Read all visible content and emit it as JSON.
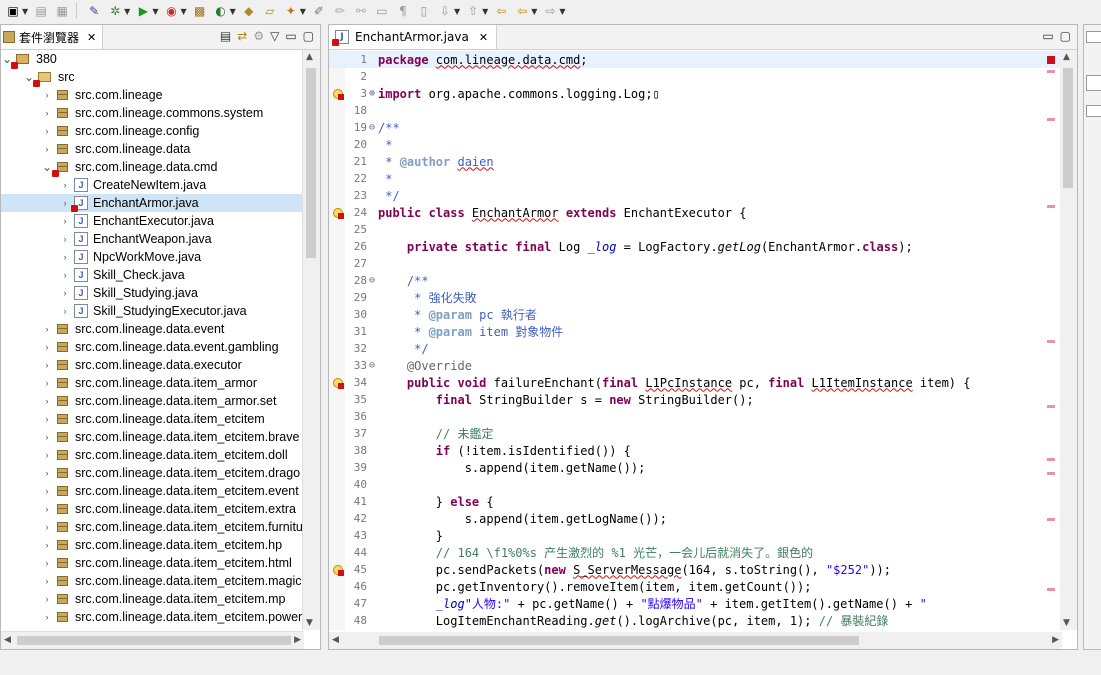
{
  "package_explorer": {
    "title": "套件瀏覽器",
    "tree": [
      {
        "label": "380",
        "type": "project",
        "level": 0,
        "expanded": true,
        "error": true
      },
      {
        "label": "src",
        "type": "srcfolder",
        "level": 1,
        "expanded": true,
        "error": true
      },
      {
        "label": "src.com.lineage",
        "type": "package",
        "level": 2
      },
      {
        "label": "src.com.lineage.commons.system",
        "type": "package",
        "level": 2
      },
      {
        "label": "src.com.lineage.config",
        "type": "package",
        "level": 2
      },
      {
        "label": "src.com.lineage.data",
        "type": "package",
        "level": 2
      },
      {
        "label": "src.com.lineage.data.cmd",
        "type": "package",
        "level": 2,
        "expanded": true,
        "error": true
      },
      {
        "label": "CreateNewItem.java",
        "type": "java",
        "level": 3
      },
      {
        "label": "EnchantArmor.java",
        "type": "java",
        "level": 3,
        "selected": true,
        "error": true
      },
      {
        "label": "EnchantExecutor.java",
        "type": "java",
        "level": 3
      },
      {
        "label": "EnchantWeapon.java",
        "type": "java",
        "level": 3
      },
      {
        "label": "NpcWorkMove.java",
        "type": "java",
        "level": 3
      },
      {
        "label": "Skill_Check.java",
        "type": "java",
        "level": 3
      },
      {
        "label": "Skill_Studying.java",
        "type": "java",
        "level": 3
      },
      {
        "label": "Skill_StudyingExecutor.java",
        "type": "java",
        "level": 3
      },
      {
        "label": "src.com.lineage.data.event",
        "type": "package",
        "level": 2
      },
      {
        "label": "src.com.lineage.data.event.gambling",
        "type": "package",
        "level": 2
      },
      {
        "label": "src.com.lineage.data.executor",
        "type": "package",
        "level": 2
      },
      {
        "label": "src.com.lineage.data.item_armor",
        "type": "package",
        "level": 2
      },
      {
        "label": "src.com.lineage.data.item_armor.set",
        "type": "package",
        "level": 2
      },
      {
        "label": "src.com.lineage.data.item_etcitem",
        "type": "package",
        "level": 2
      },
      {
        "label": "src.com.lineage.data.item_etcitem.brave",
        "type": "package",
        "level": 2
      },
      {
        "label": "src.com.lineage.data.item_etcitem.doll",
        "type": "package",
        "level": 2
      },
      {
        "label": "src.com.lineage.data.item_etcitem.drago",
        "type": "package",
        "level": 2
      },
      {
        "label": "src.com.lineage.data.item_etcitem.event",
        "type": "package",
        "level": 2
      },
      {
        "label": "src.com.lineage.data.item_etcitem.extra",
        "type": "package",
        "level": 2
      },
      {
        "label": "src.com.lineage.data.item_etcitem.furnitu",
        "type": "package",
        "level": 2
      },
      {
        "label": "src.com.lineage.data.item_etcitem.hp",
        "type": "package",
        "level": 2
      },
      {
        "label": "src.com.lineage.data.item_etcitem.html",
        "type": "package",
        "level": 2
      },
      {
        "label": "src.com.lineage.data.item_etcitem.magic",
        "type": "package",
        "level": 2
      },
      {
        "label": "src.com.lineage.data.item_etcitem.mp",
        "type": "package",
        "level": 2
      },
      {
        "label": "src.com.lineage.data.item_etcitem.power",
        "type": "package",
        "level": 2
      }
    ]
  },
  "editor": {
    "tab_title": "EnchantArmor.java",
    "lines": [
      {
        "n": "1",
        "fold": "",
        "mk": "",
        "cur": true,
        "segs": [
          [
            "kw",
            "package "
          ],
          [
            "und",
            "com.lineage.data.cmd"
          ],
          [
            "",
            "; "
          ]
        ]
      },
      {
        "n": "2",
        "fold": "",
        "mk": "",
        "segs": []
      },
      {
        "n": "3",
        "fold": "⊕",
        "mk": "err",
        "segs": [
          [
            "kw",
            "import "
          ],
          [
            "",
            "org.apache.commons.logging.Log;▯"
          ]
        ]
      },
      {
        "n": "18",
        "fold": "",
        "mk": "",
        "segs": []
      },
      {
        "n": "19",
        "fold": "⊖",
        "mk": "",
        "segs": [
          [
            "jd",
            "/**"
          ]
        ]
      },
      {
        "n": "20",
        "fold": "",
        "mk": "",
        "segs": [
          [
            "jd",
            " *"
          ]
        ]
      },
      {
        "n": "21",
        "fold": "",
        "mk": "",
        "segs": [
          [
            "jd",
            " * "
          ],
          [
            "jdt",
            "@author "
          ],
          [
            "jd und",
            "daien"
          ]
        ]
      },
      {
        "n": "22",
        "fold": "",
        "mk": "",
        "segs": [
          [
            "jd",
            " *"
          ]
        ]
      },
      {
        "n": "23",
        "fold": "",
        "mk": "",
        "segs": [
          [
            "jd",
            " */"
          ]
        ]
      },
      {
        "n": "24",
        "fold": "",
        "mk": "err",
        "segs": [
          [
            "kw",
            "public class "
          ],
          [
            "und",
            "EnchantArmor"
          ],
          [
            "kw",
            " extends "
          ],
          [
            "",
            "EnchantExecutor {"
          ]
        ]
      },
      {
        "n": "25",
        "fold": "",
        "mk": "",
        "segs": []
      },
      {
        "n": "26",
        "fold": "",
        "mk": "",
        "segs": [
          [
            "",
            "    "
          ],
          [
            "kw",
            "private static final "
          ],
          [
            "",
            "Log "
          ],
          [
            "fld it",
            "_log"
          ],
          [
            "",
            " = LogFactory."
          ],
          [
            "it",
            "getLog"
          ],
          [
            "",
            "(EnchantArmor."
          ],
          [
            "kw",
            "class"
          ],
          [
            "",
            ");"
          ]
        ]
      },
      {
        "n": "27",
        "fold": "",
        "mk": "",
        "segs": []
      },
      {
        "n": "28",
        "fold": "⊖",
        "mk": "",
        "segs": [
          [
            "jd",
            "    /**"
          ]
        ]
      },
      {
        "n": "29",
        "fold": "",
        "mk": "",
        "segs": [
          [
            "jd",
            "     * 強化失敗"
          ]
        ]
      },
      {
        "n": "30",
        "fold": "",
        "mk": "",
        "segs": [
          [
            "jd",
            "     * "
          ],
          [
            "jdt",
            "@param "
          ],
          [
            "jd",
            "pc 執行者"
          ]
        ]
      },
      {
        "n": "31",
        "fold": "",
        "mk": "",
        "segs": [
          [
            "jd",
            "     * "
          ],
          [
            "jdt",
            "@param "
          ],
          [
            "jd",
            "item 對象物件"
          ]
        ]
      },
      {
        "n": "32",
        "fold": "",
        "mk": "",
        "segs": [
          [
            "jd",
            "     */"
          ]
        ]
      },
      {
        "n": "33",
        "fold": "⊖",
        "mk": "",
        "segs": [
          [
            "ann",
            "    @Override"
          ]
        ]
      },
      {
        "n": "34",
        "fold": "",
        "mk": "err",
        "segs": [
          [
            "",
            "    "
          ],
          [
            "kw",
            "public void "
          ],
          [
            "",
            "failureEnchant("
          ],
          [
            "kw",
            "final "
          ],
          [
            "und",
            "L1PcInstance"
          ],
          [
            "",
            " pc, "
          ],
          [
            "kw",
            "final "
          ],
          [
            "und",
            "L1ItemInstance"
          ],
          [
            "",
            " item) {"
          ]
        ]
      },
      {
        "n": "35",
        "fold": "",
        "mk": "",
        "segs": [
          [
            "",
            "        "
          ],
          [
            "kw",
            "final "
          ],
          [
            "",
            "StringBuilder s = "
          ],
          [
            "kw",
            "new "
          ],
          [
            "",
            "StringBuilder();"
          ]
        ]
      },
      {
        "n": "36",
        "fold": "",
        "mk": "",
        "segs": []
      },
      {
        "n": "37",
        "fold": "",
        "mk": "",
        "segs": [
          [
            "cm",
            "        // 未鑑定"
          ]
        ]
      },
      {
        "n": "38",
        "fold": "",
        "mk": "",
        "segs": [
          [
            "",
            "        "
          ],
          [
            "kw",
            "if "
          ],
          [
            "",
            "(!item.isIdentified()) {"
          ]
        ]
      },
      {
        "n": "39",
        "fold": "",
        "mk": "",
        "segs": [
          [
            "",
            "            s.append(item.getName());"
          ]
        ]
      },
      {
        "n": "40",
        "fold": "",
        "mk": "",
        "segs": []
      },
      {
        "n": "41",
        "fold": "",
        "mk": "",
        "segs": [
          [
            "",
            "        } "
          ],
          [
            "kw",
            "else "
          ],
          [
            "",
            "{"
          ]
        ]
      },
      {
        "n": "42",
        "fold": "",
        "mk": "",
        "segs": [
          [
            "",
            "            s.append(item.getLogName());"
          ]
        ]
      },
      {
        "n": "43",
        "fold": "",
        "mk": "",
        "segs": [
          [
            "",
            "        }"
          ]
        ]
      },
      {
        "n": "44",
        "fold": "",
        "mk": "",
        "segs": [
          [
            "cm",
            "        // 164 \\f1%0%s 产生激烈的 %1 光芒，一会儿后就消失了。銀色的"
          ]
        ]
      },
      {
        "n": "45",
        "fold": "",
        "mk": "err",
        "segs": [
          [
            "",
            "        pc.sendPackets("
          ],
          [
            "kw",
            "new "
          ],
          [
            "und",
            "S_ServerMessage"
          ],
          [
            "",
            "(164, s.toString(), "
          ],
          [
            "str",
            "\"$252\""
          ],
          [
            "",
            "));"
          ]
        ]
      },
      {
        "n": "46",
        "fold": "",
        "mk": "",
        "segs": [
          [
            "",
            "        pc.getInventory().removeItem(item, item.getCount());"
          ]
        ]
      },
      {
        "n": "47",
        "fold": "",
        "mk": "",
        "segs": [
          [
            "",
            "        "
          ],
          [
            "fld it",
            "_log"
          ],
          [
            ".info(",
            ""
          ],
          [
            "str",
            "\"人物:\""
          ],
          [
            "",
            " + pc.getName() + "
          ],
          [
            "str",
            "\"點爆物品\""
          ],
          [
            "",
            " + item.getItem().getName() + "
          ],
          [
            "str",
            "\""
          ]
        ]
      },
      {
        "n": "48",
        "fold": "",
        "mk": "",
        "segs": [
          [
            "",
            "        LogItemEnchantReading."
          ],
          [
            "it",
            "get"
          ],
          [
            "",
            "().logArchive(pc, item, 1); "
          ],
          [
            "cm",
            "// 暴裝紀錄"
          ]
        ]
      }
    ]
  }
}
